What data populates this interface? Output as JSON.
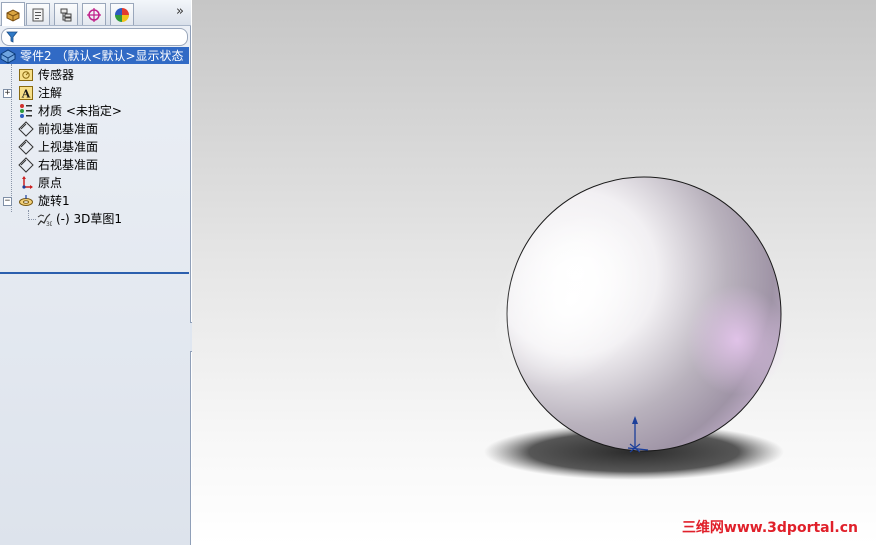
{
  "toolbar": {
    "tabs": [
      {
        "icon": "feature-manager-icon",
        "active": true
      },
      {
        "icon": "property-manager-icon",
        "active": false
      },
      {
        "icon": "configuration-manager-icon",
        "active": false
      },
      {
        "icon": "dimxpert-icon",
        "active": false
      },
      {
        "icon": "display-manager-icon",
        "active": false
      }
    ],
    "overflow_glyph": "»"
  },
  "filter": {
    "icon": "filter-icon"
  },
  "tree": {
    "root_label": "零件2 （默认<默认>显示状态",
    "items": [
      {
        "label": "传感器",
        "icon": "sensor-folder-icon",
        "expandable": false
      },
      {
        "label": "注解",
        "icon": "annotations-icon",
        "expandable": true,
        "expander": "+"
      },
      {
        "label": "材质 <未指定>",
        "icon": "material-icon",
        "expandable": false
      },
      {
        "label": "前视基准面",
        "icon": "plane-icon",
        "expandable": false
      },
      {
        "label": "上视基准面",
        "icon": "plane-icon",
        "expandable": false
      },
      {
        "label": "右视基准面",
        "icon": "plane-icon",
        "expandable": false
      },
      {
        "label": "原点",
        "icon": "origin-icon",
        "expandable": false
      },
      {
        "label": "旋转1",
        "icon": "revolve-feature-icon",
        "expandable": true,
        "expander": "−"
      },
      {
        "label": "(-) 3D草图1",
        "icon": "3d-sketch-icon",
        "expandable": false,
        "child": true
      }
    ]
  },
  "watermark": "三维网www.3dportal.cn",
  "colors": {
    "selection": "#316ac5",
    "watermark": "#e0202a",
    "sphere_highlight": "#ffffff",
    "sphere_tint": "#d8b4e0"
  }
}
